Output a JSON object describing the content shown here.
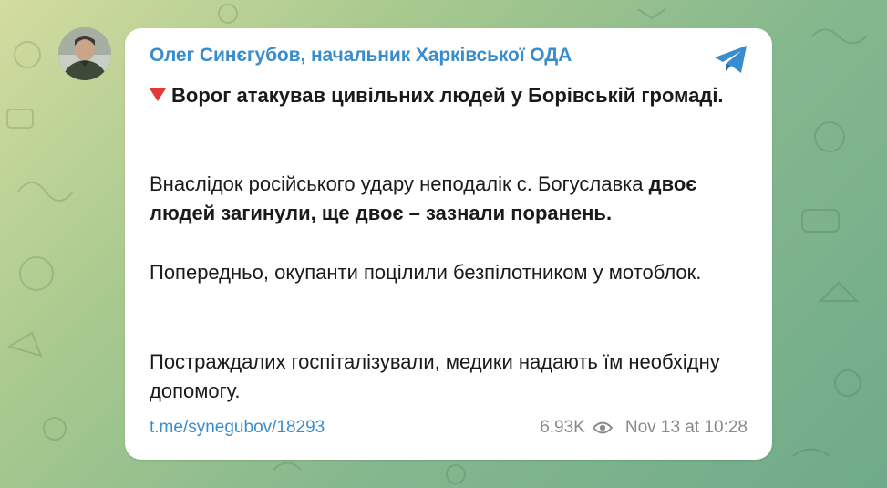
{
  "post": {
    "author": "Олег Синєгубов, начальник Харківської ОДА",
    "headline": "Ворог атакував цивільних людей у Борівській громаді.",
    "paragraph2_plain": "Внаслідок російського удару неподалік с. Богуславка ",
    "paragraph2_bold": "двоє людей загинули, ще двоє – зазнали поранень.",
    "paragraph3": "Попередньо, окупанти поцілили безпілотником у мотоблок.",
    "paragraph4": "Постраждалих госпіталізували, медики надають їм необхідну допомогу.",
    "link": "t.me/synegubov/18293",
    "views": "6.93K",
    "date": "Nov 13 at 10:28"
  },
  "icons": {
    "headline_marker": "red-down-triangle-icon",
    "views": "eye-icon",
    "app": "telegram-icon"
  },
  "colors": {
    "accent": "#3a8dcc",
    "marker": "#e23a3a",
    "meta": "#8a8a8a"
  }
}
